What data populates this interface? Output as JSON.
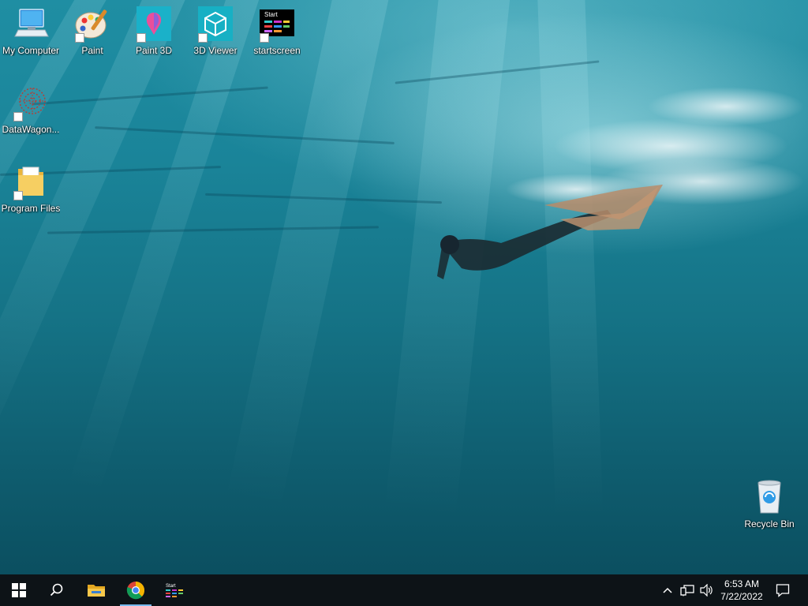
{
  "desktop": {
    "icons": [
      {
        "label": "My Computer",
        "icon": "computer-icon"
      },
      {
        "label": "Paint",
        "icon": "paint-palette-icon"
      },
      {
        "label": "Paint 3D",
        "icon": "paint-3d-icon"
      },
      {
        "label": "3D Viewer",
        "icon": "3d-viewer-cube-icon"
      },
      {
        "label": "startscreen",
        "icon": "startscreen-icon",
        "caption": "Start"
      },
      {
        "label": "DataWagon...",
        "icon": "datawagon-icon"
      },
      {
        "label": "Program Files",
        "icon": "folder-icon"
      },
      {
        "label": "Recycle Bin",
        "icon": "recycle-bin-icon"
      }
    ]
  },
  "taskbar": {
    "buttons": [
      {
        "icon": "windows-start-icon"
      },
      {
        "icon": "search-icon"
      },
      {
        "icon": "file-explorer-icon"
      },
      {
        "icon": "chrome-icon"
      },
      {
        "icon": "startscreen-icon",
        "caption": "Start"
      }
    ],
    "tray": {
      "icons": [
        "chevron-up-icon",
        "network-icon",
        "volume-icon",
        "notification-icon"
      ],
      "time": "6:53 AM",
      "date": "7/22/2022"
    },
    "accent_color": "#76b9ed"
  }
}
